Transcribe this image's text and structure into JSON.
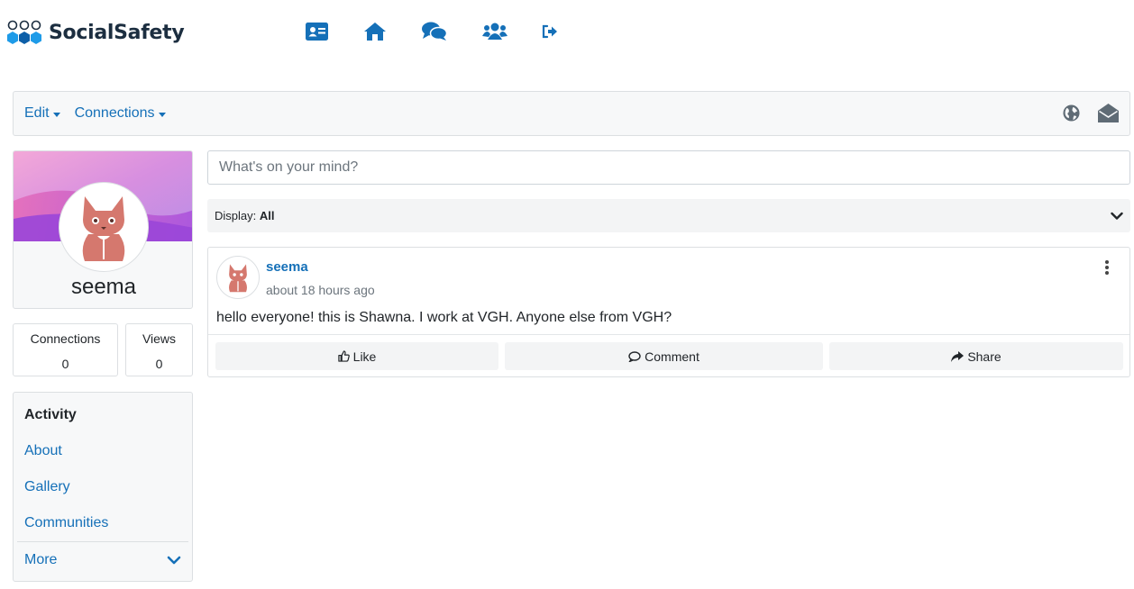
{
  "brand": {
    "name": "SocialSafety",
    "accent": "#1570b8",
    "logo_blue": "#1e9be8"
  },
  "nav": {
    "icons": [
      "profile-card-icon",
      "home-icon",
      "chat-icon",
      "users-icon",
      "sign-out-icon"
    ]
  },
  "toolbar": {
    "edit_label": "Edit",
    "connections_label": "Connections",
    "right_icons": [
      "globe-icon",
      "envelope-open-icon"
    ]
  },
  "profile": {
    "username": "seema",
    "stats": [
      {
        "label": "Connections",
        "value": "0"
      },
      {
        "label": "Views",
        "value": "0"
      }
    ]
  },
  "sidenav": {
    "items": [
      {
        "label": "Activity",
        "active": true
      },
      {
        "label": "About"
      },
      {
        "label": "Gallery"
      },
      {
        "label": "Communities"
      },
      {
        "label": "More"
      }
    ]
  },
  "composer": {
    "placeholder": "What's on your mind?"
  },
  "display": {
    "prefix": "Display:",
    "value": "All"
  },
  "post": {
    "author": "seema",
    "time": "about 18 hours ago",
    "body": "hello everyone! this is Shawna. I work at VGH. Anyone else from VGH?",
    "actions": {
      "like": "Like",
      "comment": "Comment",
      "share": "Share"
    }
  }
}
